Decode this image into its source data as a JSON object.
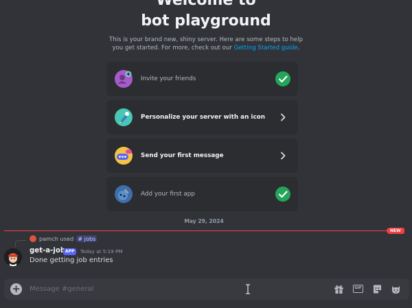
{
  "welcome": {
    "title_line1": "Welcome to",
    "title_line2": "bot playground",
    "subtitle": "This is your brand new, shiny server. Here are some steps to help you get started. For more, check out our",
    "subtitle_link": "Getting Started guide",
    "subtitle_end": "."
  },
  "checklist": [
    {
      "label": "Invite your friends",
      "icon": "invite-friends-icon",
      "status": "done",
      "status_icon": "check-icon"
    },
    {
      "label": "Personalize your server with an icon",
      "icon": "personalize-brush-icon",
      "status": "todo",
      "status_icon": "chevron-right-icon"
    },
    {
      "label": "Send your first message",
      "icon": "message-bubble-icon",
      "status": "todo",
      "status_icon": "chevron-right-icon"
    },
    {
      "label": "Add your first app",
      "icon": "add-app-icon",
      "status": "done",
      "status_icon": "check-icon"
    }
  ],
  "divider": {
    "date": "May 29, 2024",
    "new_badge": "NEW"
  },
  "message": {
    "reply_user": "pamch",
    "reply_used": "used",
    "reply_command": "# jobs",
    "author": "get-a-job",
    "badge": "APP",
    "timestamp": "Today at 5:19 PM",
    "text": "Done getting job entries"
  },
  "composer": {
    "placeholder": "Message #general",
    "gif_label": "GIF",
    "tools": [
      "gift-icon",
      "gif-icon",
      "sticker-icon",
      "emoji-icon"
    ]
  },
  "colors": {
    "background": "#313338",
    "card": "#2b2d31",
    "check": "#23a55a",
    "new_line": "#f23f43",
    "link": "#00a8fc",
    "app_badge": "#5865f2"
  }
}
